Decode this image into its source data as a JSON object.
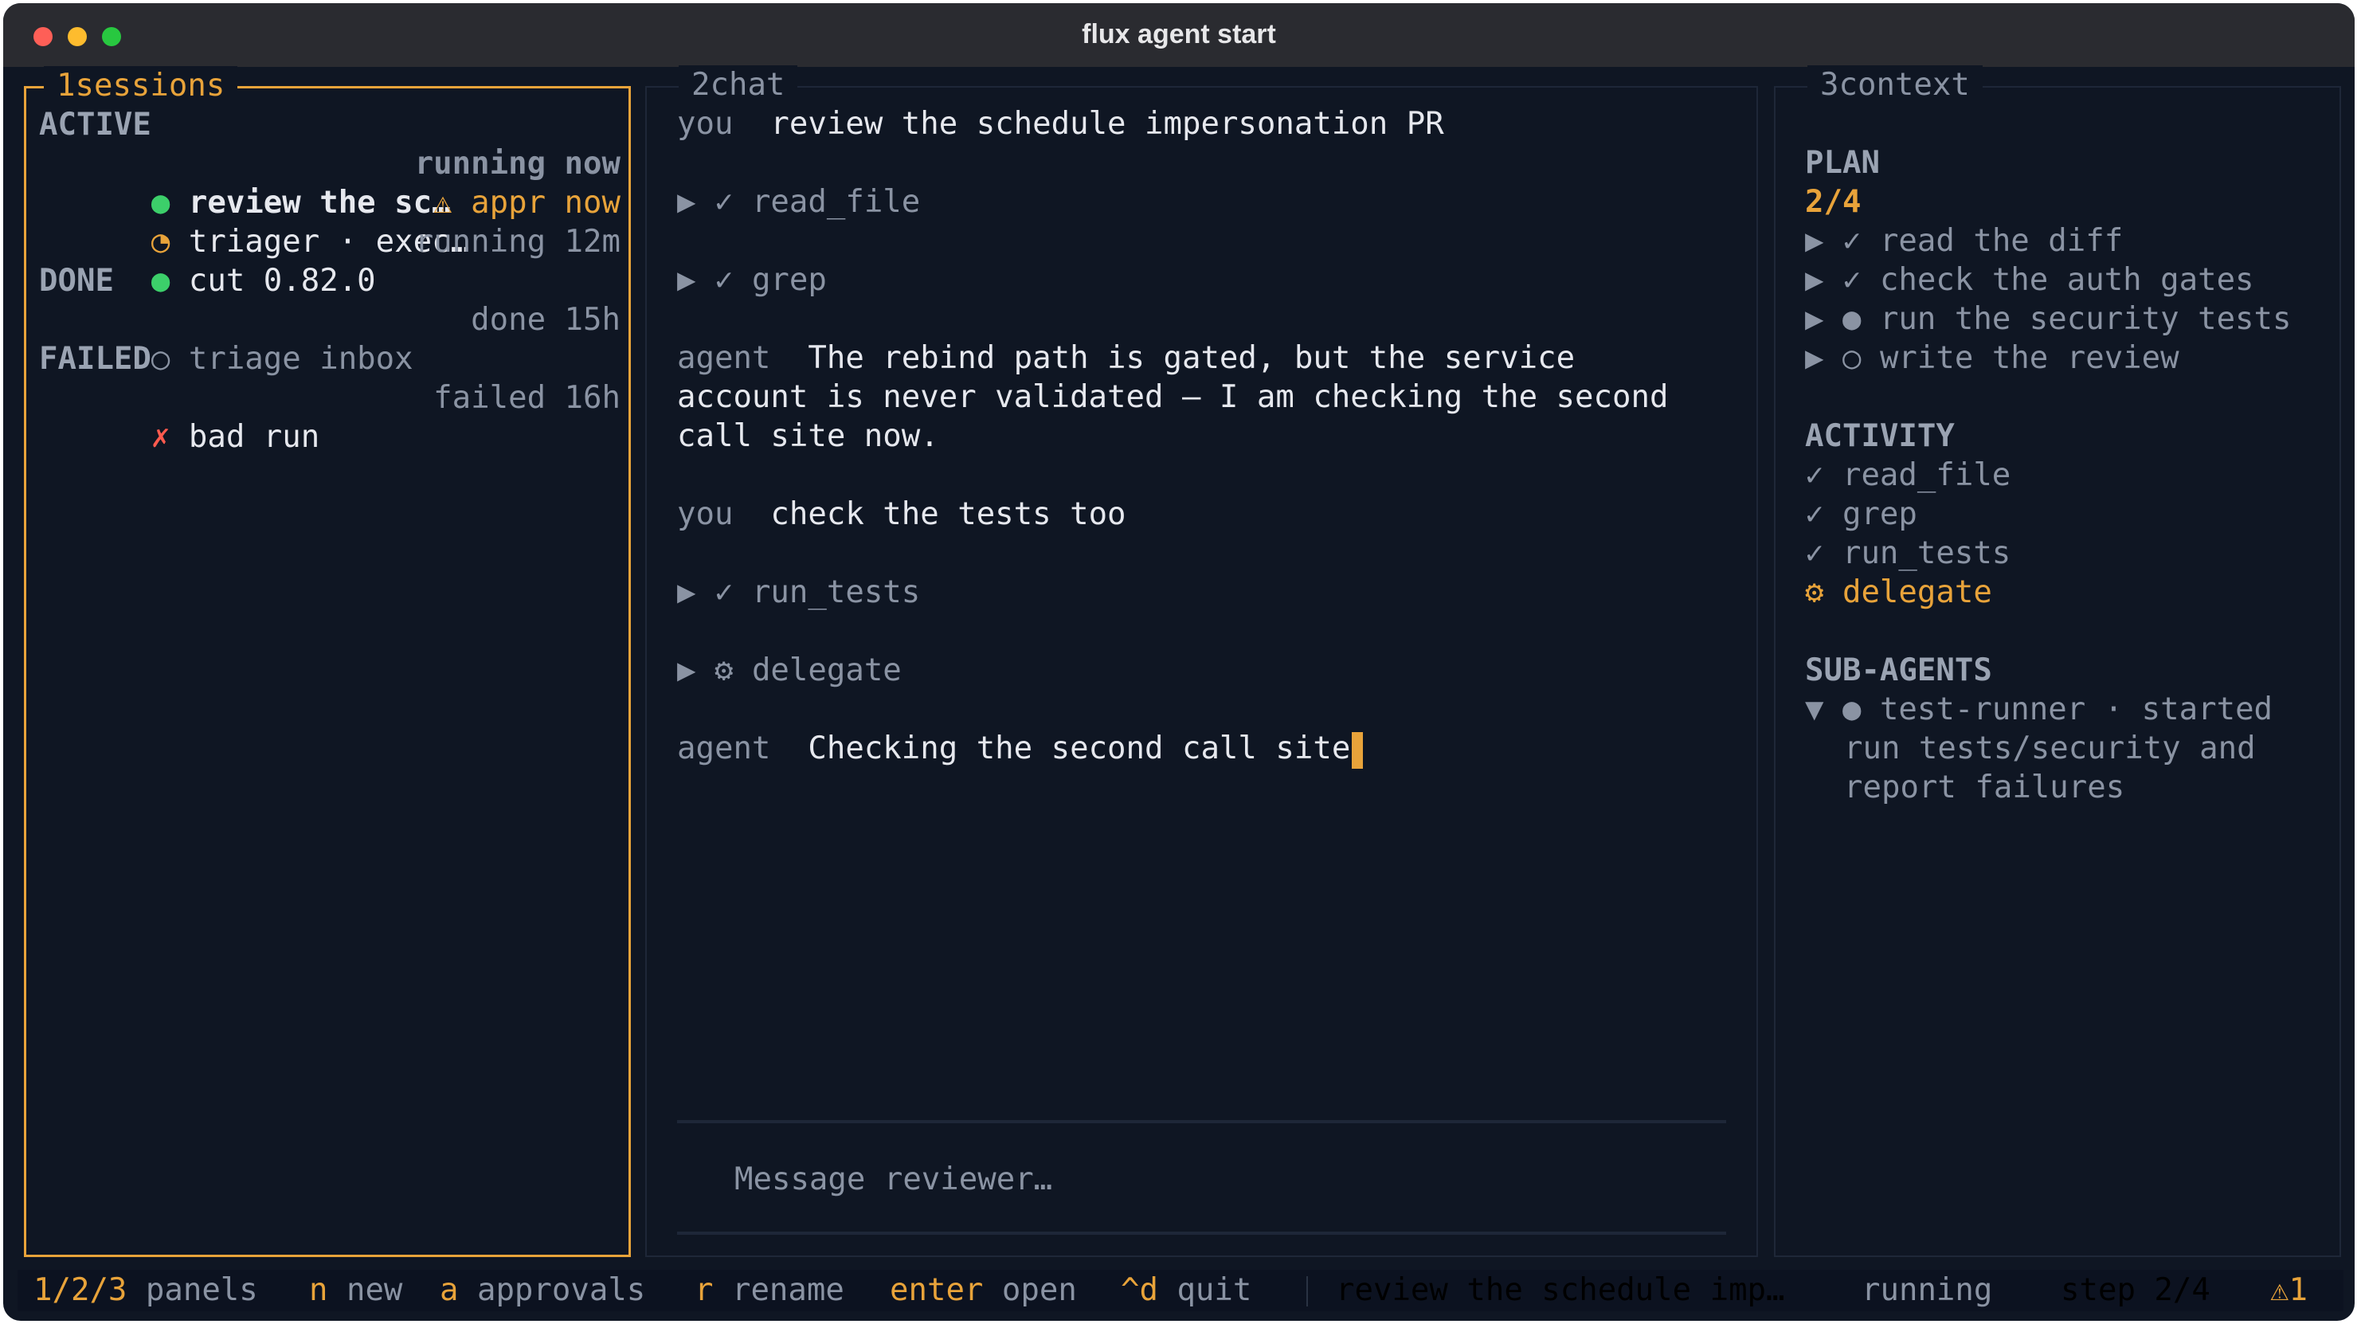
{
  "window": {
    "title": "flux agent start"
  },
  "sessions": {
    "panel_title": "1sessions",
    "active_heading": "ACTIVE",
    "active": [
      {
        "icon": "●",
        "name": "review the sc…",
        "status": "running",
        "time": "now"
      },
      {
        "icon": "◔",
        "name": "triager · exec…",
        "status_icon": "⚠",
        "status": "appr",
        "time": "now"
      },
      {
        "icon": "●",
        "name": "cut 0.82.0",
        "status": "running",
        "time": "12m"
      }
    ],
    "done_heading": "DONE",
    "done": [
      {
        "icon": "○",
        "name": "triage inbox",
        "status": "done",
        "time": "15h"
      }
    ],
    "failed_heading": "FAILED",
    "failed": [
      {
        "icon": "✗",
        "name": "bad run",
        "status": "failed",
        "time": "16h"
      }
    ]
  },
  "chat": {
    "panel_title": "2chat",
    "messages": [
      {
        "role": "you",
        "text": "review the schedule impersonation PR"
      },
      {
        "tool": "read_file",
        "expander": "▶",
        "status_icon": "✓"
      },
      {
        "tool": "grep",
        "expander": "▶",
        "status_icon": "✓"
      },
      {
        "role": "agent",
        "line1": "The rebind path is gated, but the service",
        "line2": "account is never validated — I am checking the second",
        "line3": "call site now."
      },
      {
        "role": "you",
        "text": "check the tests too"
      },
      {
        "tool": "run_tests",
        "expander": "▶",
        "status_icon": "✓"
      },
      {
        "tool": "delegate",
        "expander": "▶",
        "status_icon": "⚙"
      },
      {
        "role": "agent",
        "text": "Checking the second call site"
      }
    ],
    "input_placeholder": "Message reviewer…"
  },
  "context": {
    "panel_title": "3context",
    "plan_heading": "PLAN",
    "plan_progress": "2/4",
    "plan_items": [
      {
        "expander": "▶",
        "icon": "✓",
        "label": "read the diff"
      },
      {
        "expander": "▶",
        "icon": "✓",
        "label": "check the auth gates"
      },
      {
        "expander": "▶",
        "icon": "●",
        "label": "run the security tests"
      },
      {
        "expander": "▶",
        "icon": "○",
        "label": "write the review"
      }
    ],
    "activity_heading": "ACTIVITY",
    "activity_items": [
      {
        "icon": "✓",
        "label": "read_file"
      },
      {
        "icon": "✓",
        "label": "grep"
      },
      {
        "icon": "✓",
        "label": "run_tests"
      },
      {
        "icon": "⚙",
        "label": "delegate"
      }
    ],
    "subagents_heading": "SUB-AGENTS",
    "subagent": {
      "expander": "▼",
      "icon": "●",
      "name": "test-runner",
      "separator": "·",
      "state": "started",
      "task_line1": "run tests/security and",
      "task_line2": "report failures"
    }
  },
  "statusbar": {
    "hints": [
      {
        "key": "1/2/3",
        "label": "panels"
      },
      {
        "key": "n",
        "label": "new"
      },
      {
        "key": "a",
        "label": "approvals"
      },
      {
        "key": "r",
        "label": "rename"
      },
      {
        "key": "enter",
        "label": "open"
      },
      {
        "key": "^d",
        "label": "quit"
      }
    ],
    "session": "review the schedule imp…",
    "state": "running",
    "step": "step 2/4",
    "warnings": "⚠1"
  },
  "colors": {
    "background": "#0f1623",
    "accent": "#e8a33a",
    "running_green": "#3ccf6a",
    "failed_red": "#ff5a4e",
    "dim_text": "#8a93a3",
    "text": "#e6e8ee"
  }
}
